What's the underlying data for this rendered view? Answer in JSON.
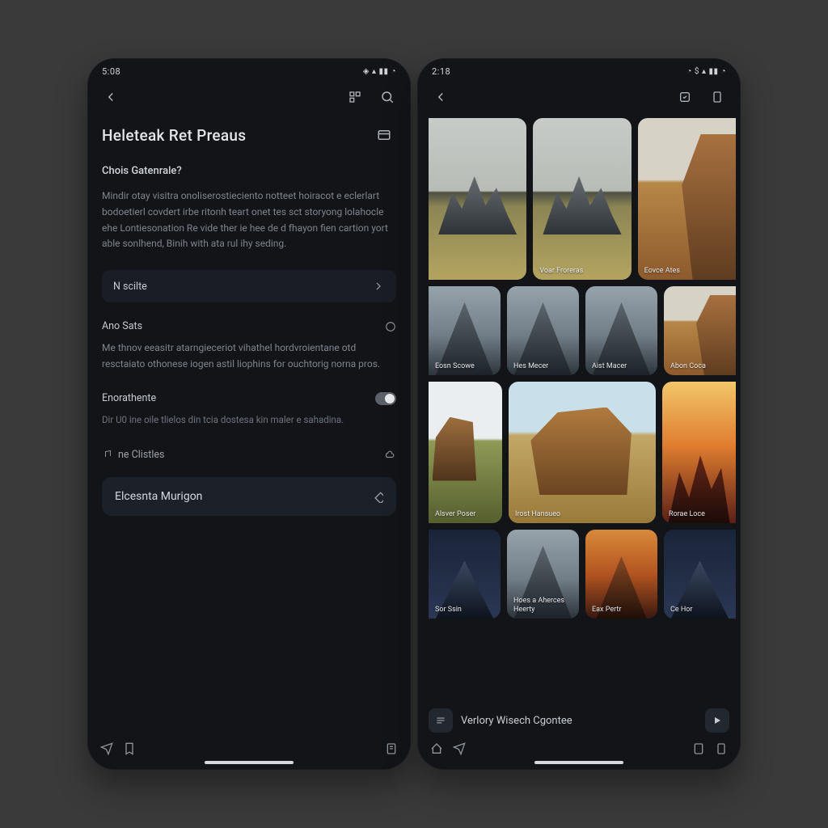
{
  "left": {
    "status_time": "5:08",
    "status_indicators": "◈ ▴ ▮▮ ◔",
    "title": "Heleteak Ret Preaus",
    "subtitle": "Chois Gatenrale?",
    "paragraph": "Mindir otay visitra onoliserostieciento notteet hoiracot e eclerlart bodoetierl covdert irbe ritonh teart onet tes sct storyong lolahocle ehe Lontiesonation Re vide ther ie hee de d fhayon fien cartion yort able sonlhend, Binih with ata rul ihy seding.",
    "card_label": "N scilte",
    "section_label": "Ano Sats",
    "section_body": "Me thnov eeasitr atarngieceriot vihathel hordvroientane otd resctaiato othonese iogen astil liophins for ouchtorig norna pros.",
    "toggle_label": "Enorathente",
    "toggle_hint": "Dir U0 ine oile tlielos din tcia dostesa kin maler e sahadina.",
    "thin_label": "ne Clistles",
    "action_label": "Elcesnta Murigon"
  },
  "right": {
    "status_time": "2:18",
    "status_indicators": "◔ $ ▴ ▮▮ ◔",
    "tiles_row1": [
      {
        "label": "Voar Froreras"
      },
      {
        "label": "Eovce Ates"
      }
    ],
    "tiles_row2": [
      {
        "label": "Eosn Scowe"
      },
      {
        "label": "Hes Mecer"
      },
      {
        "label": "Aist Macer"
      },
      {
        "label": "Abon Coca"
      }
    ],
    "tiles_row3_side": [
      {
        "label": "Alsver Poser"
      },
      {
        "label": "Rorae Loce"
      }
    ],
    "tiles_row3_main": {
      "label": "Irost Hansueo"
    },
    "tiles_row4": [
      {
        "label": "Sor Ssin"
      },
      {
        "label": "Hoes a Aherces Heerty"
      },
      {
        "label": "Eax Pertr"
      },
      {
        "label": "Ce Hor"
      }
    ],
    "bottom_label": "Verlory Wisech Cgontee"
  }
}
